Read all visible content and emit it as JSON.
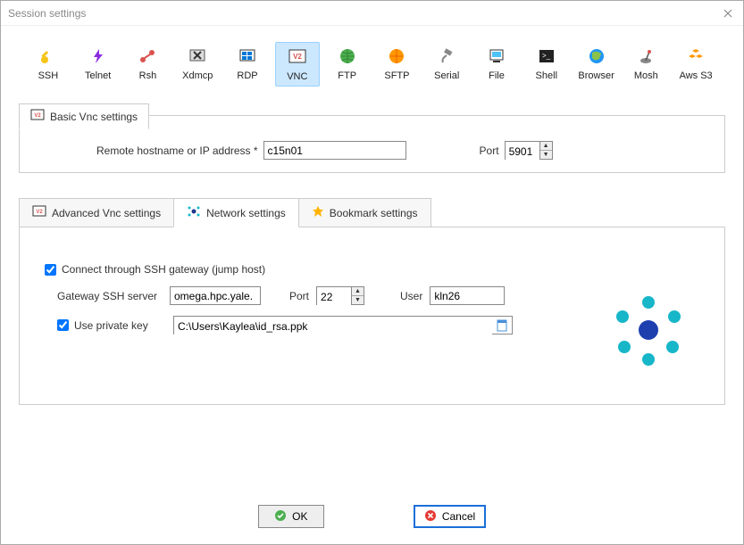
{
  "window": {
    "title": "Session settings"
  },
  "protocols": [
    {
      "key": "ssh",
      "label": "SSH"
    },
    {
      "key": "telnet",
      "label": "Telnet"
    },
    {
      "key": "rsh",
      "label": "Rsh"
    },
    {
      "key": "xdmcp",
      "label": "Xdmcp"
    },
    {
      "key": "rdp",
      "label": "RDP"
    },
    {
      "key": "vnc",
      "label": "VNC",
      "selected": true
    },
    {
      "key": "ftp",
      "label": "FTP"
    },
    {
      "key": "sftp",
      "label": "SFTP"
    },
    {
      "key": "serial",
      "label": "Serial"
    },
    {
      "key": "file",
      "label": "File"
    },
    {
      "key": "shell",
      "label": "Shell"
    },
    {
      "key": "browser",
      "label": "Browser"
    },
    {
      "key": "mosh",
      "label": "Mosh"
    },
    {
      "key": "awss3",
      "label": "Aws S3"
    }
  ],
  "basic": {
    "tab_label": "Basic Vnc settings",
    "host_label": "Remote hostname or IP address *",
    "host_value": "c15n01",
    "port_label": "Port",
    "port_value": "5901"
  },
  "tabs": {
    "advanced": "Advanced Vnc settings",
    "network": "Network settings",
    "bookmark": "Bookmark settings"
  },
  "network": {
    "ssh_gateway_label": "Connect through SSH gateway (jump host)",
    "ssh_gateway_checked": true,
    "gw_label": "Gateway SSH server",
    "gw_value": "omega.hpc.yale.",
    "gw_port_label": "Port",
    "gw_port_value": "22",
    "gw_user_label": "User",
    "gw_user_value": "kln26",
    "pk_label": "Use private key",
    "pk_checked": true,
    "pk_path": "C:\\Users\\Kaylea\\id_rsa.ppk"
  },
  "buttons": {
    "ok": "OK",
    "cancel": "Cancel"
  }
}
